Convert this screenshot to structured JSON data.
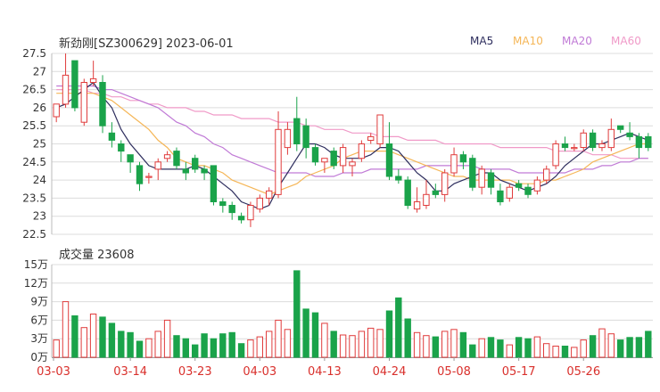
{
  "header": {
    "title": "新劲刚[SZ300629] 2023-06-01"
  },
  "legend": [
    {
      "label": "MA5",
      "color": "#2e2e5e"
    },
    {
      "label": "MA10",
      "color": "#f5b657"
    },
    {
      "label": "MA20",
      "color": "#c07ad6"
    },
    {
      "label": "MA60",
      "color": "#f09ac8"
    }
  ],
  "volume_header": {
    "label": "成交量 23608"
  },
  "colors": {
    "up": "#e03c3c",
    "down": "#1aa34a",
    "grid": "#dcdcdc",
    "axis_text": "#333333",
    "date_text": "#d9302c"
  },
  "chart_data": [
    {
      "type": "candlestick",
      "y_ticks": [
        "27.5",
        "27",
        "26.5",
        "26",
        "25.5",
        "25",
        "24.5",
        "24",
        "23.5",
        "23",
        "22.5"
      ],
      "ylim": [
        22.5,
        27.5
      ],
      "candles": [
        [
          25.75,
          26.1,
          26.1,
          25.6
        ],
        [
          26.1,
          26.9,
          27.5,
          26.0
        ],
        [
          27.3,
          26.0,
          27.3,
          25.9
        ],
        [
          25.6,
          26.7,
          26.8,
          25.5
        ],
        [
          26.7,
          26.8,
          27.3,
          26.6
        ],
        [
          26.7,
          25.5,
          26.9,
          25.3
        ],
        [
          25.3,
          25.1,
          25.6,
          24.9
        ],
        [
          25.0,
          24.8,
          25.1,
          24.5
        ],
        [
          24.7,
          24.5,
          24.7,
          24.2
        ],
        [
          24.4,
          23.9,
          24.5,
          23.7
        ],
        [
          24.1,
          24.1,
          24.2,
          23.9
        ],
        [
          24.3,
          24.5,
          24.6,
          24.0
        ],
        [
          24.6,
          24.7,
          24.8,
          24.5
        ],
        [
          24.8,
          24.4,
          24.9,
          24.3
        ],
        [
          24.3,
          24.2,
          24.5,
          24.0
        ],
        [
          24.6,
          24.3,
          24.7,
          24.2
        ],
        [
          24.3,
          24.2,
          24.4,
          24.0
        ],
        [
          24.4,
          23.4,
          24.4,
          23.3
        ],
        [
          23.4,
          23.3,
          23.5,
          23.1
        ],
        [
          23.3,
          23.1,
          23.4,
          22.9
        ],
        [
          23.0,
          22.9,
          23.1,
          22.8
        ],
        [
          22.9,
          23.3,
          23.4,
          22.7
        ],
        [
          23.2,
          23.5,
          23.6,
          23.1
        ],
        [
          23.5,
          23.7,
          23.8,
          23.3
        ],
        [
          23.6,
          25.4,
          25.9,
          23.5
        ],
        [
          24.9,
          25.4,
          25.6,
          24.7
        ],
        [
          25.7,
          25.0,
          26.3,
          24.8
        ],
        [
          25.5,
          24.9,
          25.7,
          24.6
        ],
        [
          24.9,
          24.5,
          25.0,
          24.4
        ],
        [
          24.5,
          24.6,
          24.6,
          24.2
        ],
        [
          24.8,
          24.4,
          24.9,
          24.3
        ],
        [
          24.4,
          24.9,
          25.0,
          24.2
        ],
        [
          24.4,
          24.5,
          24.6,
          24.1
        ],
        [
          24.6,
          25.0,
          25.1,
          24.5
        ],
        [
          25.1,
          25.2,
          25.3,
          25.0
        ],
        [
          25.0,
          25.8,
          25.8,
          24.9
        ],
        [
          25.0,
          24.1,
          25.6,
          24.0
        ],
        [
          24.1,
          24.0,
          24.3,
          23.9
        ],
        [
          24.0,
          23.3,
          24.1,
          23.2
        ],
        [
          23.2,
          23.4,
          23.8,
          23.1
        ],
        [
          23.3,
          23.6,
          24.0,
          23.2
        ],
        [
          23.7,
          23.6,
          23.9,
          23.5
        ],
        [
          23.6,
          24.2,
          24.3,
          23.4
        ],
        [
          24.2,
          24.7,
          24.9,
          24.1
        ],
        [
          24.7,
          24.5,
          24.8,
          24.3
        ],
        [
          24.6,
          23.8,
          24.7,
          23.7
        ],
        [
          23.8,
          24.3,
          24.4,
          23.6
        ],
        [
          24.2,
          23.8,
          24.3,
          23.6
        ],
        [
          23.7,
          23.4,
          23.9,
          23.3
        ],
        [
          23.5,
          23.8,
          23.9,
          23.4
        ],
        [
          23.9,
          23.8,
          24.0,
          23.7
        ],
        [
          23.8,
          23.6,
          23.9,
          23.5
        ],
        [
          23.7,
          24.0,
          24.1,
          23.6
        ],
        [
          24.0,
          24.3,
          24.4,
          23.9
        ],
        [
          24.4,
          25.0,
          25.1,
          24.3
        ],
        [
          25.0,
          24.9,
          25.2,
          24.8
        ],
        [
          24.9,
          24.9,
          25.0,
          24.8
        ],
        [
          24.9,
          25.3,
          25.4,
          24.8
        ],
        [
          25.3,
          24.9,
          25.4,
          24.8
        ],
        [
          24.9,
          25.0,
          25.1,
          24.8
        ],
        [
          24.9,
          25.4,
          25.7,
          24.8
        ],
        [
          25.5,
          25.4,
          25.5,
          25.3
        ],
        [
          25.3,
          25.2,
          25.6,
          25.1
        ],
        [
          25.2,
          24.9,
          25.3,
          24.6
        ],
        [
          25.2,
          24.9,
          25.3,
          24.8
        ]
      ],
      "ma5": [
        26.0,
        26.1,
        26.3,
        26.5,
        26.7,
        26.3,
        26.0,
        25.4,
        25.0,
        24.7,
        24.4,
        24.3,
        24.3,
        24.3,
        24.3,
        24.4,
        24.3,
        24.1,
        23.9,
        23.7,
        23.4,
        23.3,
        23.2,
        23.3,
        23.8,
        24.2,
        24.6,
        25.0,
        25.0,
        24.9,
        24.7,
        24.6,
        24.6,
        24.6,
        24.7,
        24.9,
        24.9,
        24.8,
        24.5,
        24.2,
        24.0,
        23.7,
        23.7,
        23.9,
        24.0,
        24.1,
        24.2,
        24.2,
        24.0,
        23.9,
        23.8,
        23.7,
        23.8,
        23.9,
        24.1,
        24.4,
        24.6,
        24.8,
        25.0,
        25.0,
        25.1,
        25.2,
        25.3,
        25.2,
        25.1
      ],
      "ma10": [
        26.4,
        26.4,
        26.4,
        26.4,
        26.4,
        26.3,
        26.2,
        26.0,
        25.8,
        25.6,
        25.4,
        25.1,
        24.9,
        24.6,
        24.5,
        24.4,
        24.4,
        24.3,
        24.2,
        24.0,
        23.9,
        23.8,
        23.7,
        23.6,
        23.7,
        23.8,
        23.9,
        24.1,
        24.2,
        24.3,
        24.4,
        24.6,
        24.7,
        24.8,
        24.8,
        24.8,
        24.8,
        24.7,
        24.6,
        24.5,
        24.4,
        24.3,
        24.2,
        24.1,
        24.1,
        24.0,
        24.0,
        24.0,
        24.0,
        24.0,
        23.9,
        23.9,
        23.9,
        24.0,
        24.0,
        24.1,
        24.2,
        24.3,
        24.5,
        24.6,
        24.7,
        24.8,
        24.9,
        25.0,
        25.0
      ],
      "ma20": [
        26.6,
        26.6,
        26.6,
        26.6,
        26.6,
        26.5,
        26.5,
        26.4,
        26.3,
        26.2,
        26.1,
        26.0,
        25.8,
        25.6,
        25.5,
        25.3,
        25.2,
        25.0,
        24.9,
        24.7,
        24.6,
        24.5,
        24.4,
        24.3,
        24.2,
        24.2,
        24.2,
        24.2,
        24.1,
        24.1,
        24.1,
        24.2,
        24.2,
        24.2,
        24.3,
        24.3,
        24.3,
        24.3,
        24.3,
        24.3,
        24.4,
        24.4,
        24.4,
        24.4,
        24.4,
        24.4,
        24.3,
        24.3,
        24.3,
        24.3,
        24.2,
        24.2,
        24.2,
        24.2,
        24.2,
        24.2,
        24.3,
        24.3,
        24.3,
        24.4,
        24.4,
        24.5,
        24.5,
        24.6,
        24.6
      ],
      "ma60": [
        26.5,
        26.5,
        26.5,
        26.5,
        26.4,
        26.4,
        26.3,
        26.3,
        26.2,
        26.2,
        26.1,
        26.1,
        26.0,
        26.0,
        26.0,
        25.9,
        25.9,
        25.8,
        25.8,
        25.8,
        25.7,
        25.7,
        25.7,
        25.7,
        25.6,
        25.6,
        25.6,
        25.5,
        25.5,
        25.4,
        25.4,
        25.4,
        25.3,
        25.3,
        25.3,
        25.2,
        25.2,
        25.2,
        25.1,
        25.1,
        25.1,
        25.1,
        25.0,
        25.0,
        25.0,
        25.0,
        25.0,
        25.0,
        24.9,
        24.9,
        24.9,
        24.9,
        24.9,
        24.9,
        24.8,
        24.8,
        24.8,
        24.8,
        24.7,
        24.7,
        24.7,
        24.6,
        24.6,
        24.6,
        24.6
      ]
    },
    {
      "type": "bar",
      "title": "成交量",
      "y_ticks": [
        "15万",
        "12万",
        "9万",
        "6万",
        "3万",
        "0万"
      ],
      "ylim": [
        0,
        150000
      ],
      "volumes": [
        28000,
        90000,
        67000,
        48000,
        70000,
        65000,
        55000,
        42000,
        40000,
        26000,
        30000,
        42000,
        60000,
        35000,
        30000,
        20000,
        38000,
        30000,
        38000,
        40000,
        22000,
        28000,
        33000,
        42000,
        60000,
        45000,
        140000,
        78000,
        72000,
        55000,
        42000,
        36000,
        35000,
        42000,
        47000,
        45000,
        75000,
        96000,
        62000,
        40000,
        35000,
        33000,
        42000,
        45000,
        40000,
        20000,
        30000,
        32000,
        28000,
        20000,
        32000,
        30000,
        33000,
        22000,
        18000,
        18000,
        16000,
        28000,
        35000,
        46000,
        38000,
        28000,
        32000,
        32000,
        42000
      ],
      "x_labels": [
        "03-03",
        "03-14",
        "03-23",
        "04-03",
        "04-13",
        "04-24",
        "05-08",
        "05-17",
        "05-26"
      ]
    }
  ]
}
